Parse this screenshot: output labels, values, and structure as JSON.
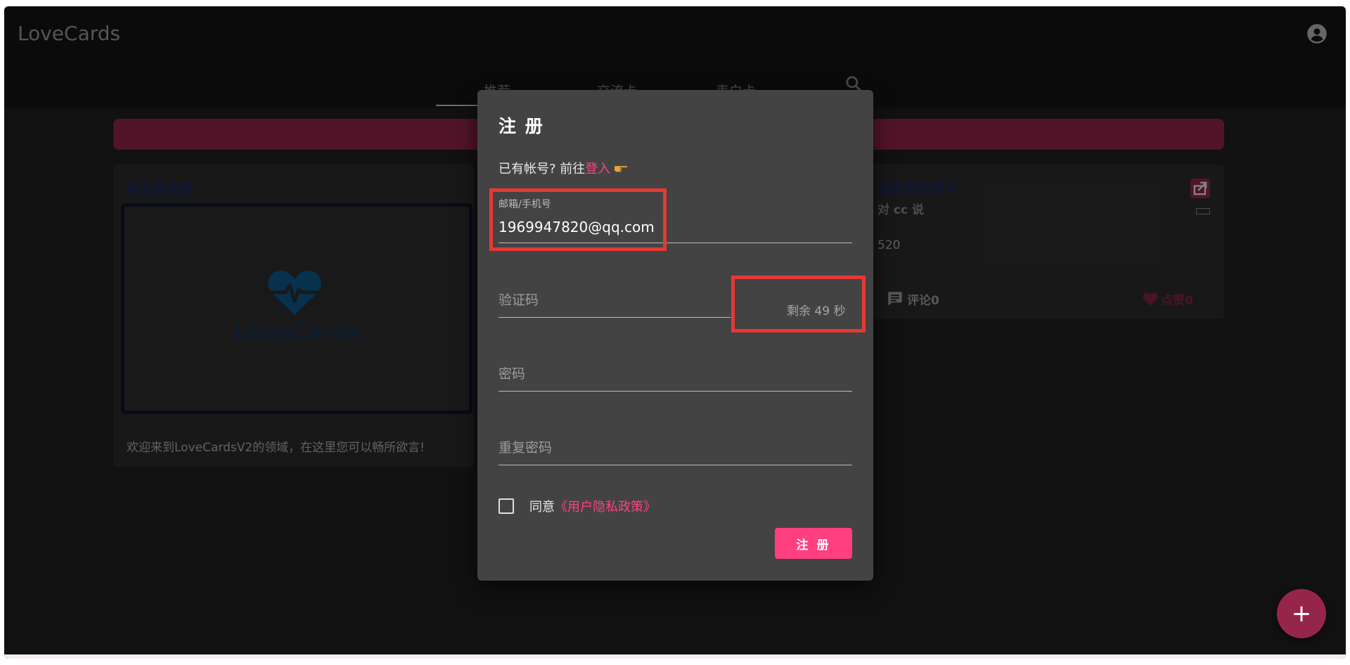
{
  "app": {
    "title": "LoveCards"
  },
  "tabs": [
    {
      "label": "推荐"
    },
    {
      "label": "交流卡"
    },
    {
      "label": "表白卡"
    }
  ],
  "icons": {
    "account": "account-circle-icon",
    "search": "search-icon",
    "share": "share-icon",
    "comment": "comment-icon",
    "like": "heart-icon",
    "add": "plus-icon",
    "point": "pointing-hand-icon"
  },
  "colors": {
    "accent": "#ff4081",
    "banner": "#96254a",
    "red_highlight": "#e53935"
  },
  "cards": {
    "left": {
      "title": "站长的便签",
      "logo_text": "LoveCards",
      "description": "欢迎来到LoveCardsV2的领域，在这里您可以畅所欲言!"
    },
    "right": {
      "title": "匿名的交流卡",
      "to": "对 cc 说",
      "content": "520",
      "comment_label": "评论0",
      "like_label": "点赞0"
    }
  },
  "dialog": {
    "title": "注 册",
    "login_prompt": "已有帐号? 前往",
    "login_link": "登入",
    "email_label": "邮箱/手机号",
    "email_value": "1969947820@qq.com",
    "code_placeholder": "验证码",
    "countdown": "剩余 49 秒",
    "password_placeholder": "密码",
    "repeat_password_placeholder": "重复密码",
    "agree_prefix": "同意",
    "policy_link": "《用户隐私政策》",
    "submit_label": "注 册"
  },
  "fab": {
    "label": "+"
  }
}
